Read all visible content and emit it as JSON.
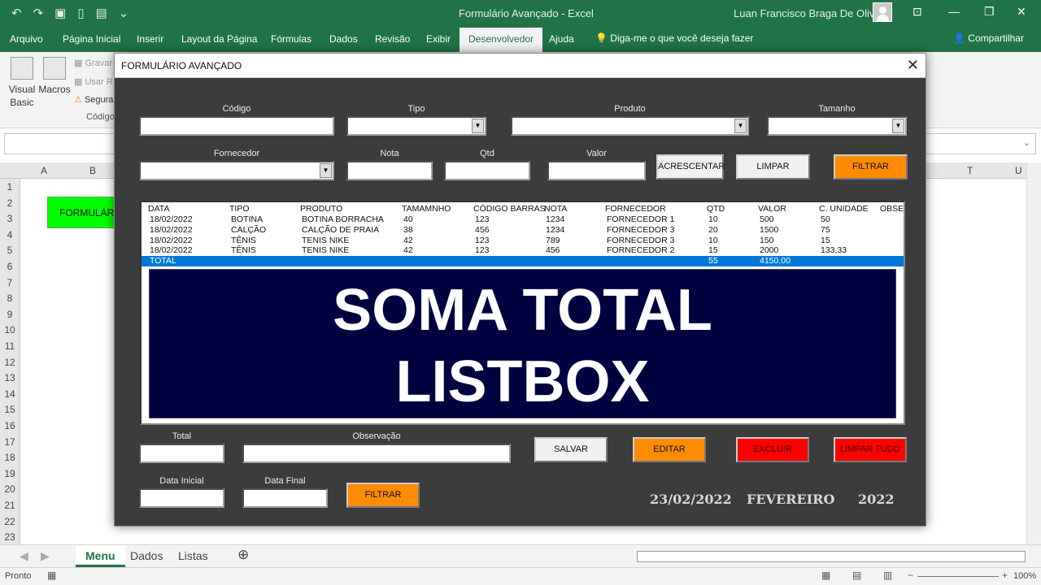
{
  "window": {
    "title": "Formulário Avançado  -  Excel",
    "user": "Luan Francisco Braga De Oliveira"
  },
  "ribbon_tabs": [
    "Arquivo",
    "Página Inicial",
    "Inserir",
    "Layout da Página",
    "Fórmulas",
    "Dados",
    "Revisão",
    "Exibir",
    "Desenvolvedor",
    "Ajuda"
  ],
  "active_tab": "Desenvolvedor",
  "tell_me": "Diga-me o que você deseja fazer",
  "share": "Compartilhar",
  "ribbon": {
    "visual_basic": "Visual Basic",
    "macros": "Macros",
    "gravar": "Gravar",
    "usar": "Usar R",
    "seguranca": "Segura",
    "group": "Código"
  },
  "columns": [
    "A",
    "B",
    "T",
    "U"
  ],
  "rows": [
    "1",
    "2",
    "3",
    "4",
    "5",
    "6",
    "7",
    "8",
    "9",
    "10",
    "11",
    "12",
    "13",
    "14",
    "15",
    "16",
    "17",
    "18",
    "19",
    "20",
    "21",
    "22",
    "23"
  ],
  "sheet_button": "FORMULÁRIO",
  "sheets": [
    "Menu",
    "Dados",
    "Listas"
  ],
  "status": "Pronto",
  "zoom": "100%",
  "form": {
    "title": "FORMULÁRIO AVANÇADO",
    "labels": {
      "codigo": "Código",
      "tipo": "Tipo",
      "produto": "Produto",
      "tamanho": "Tamanho",
      "fornecedor": "Fornecedor",
      "nota": "Nota",
      "qtd": "Qtd",
      "valor": "Valor",
      "total": "Total",
      "observacao": "Observação",
      "data_inicial": "Data Inicial",
      "data_final": "Data Final"
    },
    "buttons": {
      "acrescentar": "ACRESCENTAR",
      "limpar": "LIMPAR",
      "filtrar": "FILTRAR",
      "salvar": "SALVAR",
      "editar": "EDITAR",
      "excluir": "EXCLUIR",
      "limpar_tudo": "LIMPAR TUDO",
      "filtrar2": "FILTRAR"
    },
    "list_headers": [
      "DATA",
      "TIPO",
      "PRODUTO",
      "TAMAMNHO",
      "CÓDIGO BARRAS",
      "NOTA",
      "FORNECEDOR",
      "QTD",
      "VALOR",
      "C. UNIDADE",
      "OBSER"
    ],
    "list_rows": [
      [
        "18/02/2022",
        "BOTINA",
        "BOTINA BORRACHA",
        "40",
        "123",
        "1234",
        "FORNECEDOR 1",
        "10",
        "500",
        "50",
        ""
      ],
      [
        "18/02/2022",
        "CALÇÃO",
        "CALÇÃO DE PRAIA",
        "38",
        "456",
        "1234",
        "FORNECEDOR 3",
        "20",
        "1500",
        "75",
        ""
      ],
      [
        "18/02/2022",
        "TÊNIS",
        "TENIS NIKE",
        "42",
        "123",
        "789",
        "FORNECEDOR 3",
        "10",
        "150",
        "15",
        ""
      ],
      [
        "18/02/2022",
        "TÊNIS",
        "TENIS NIKE",
        "42",
        "123",
        "456",
        "FORNECEDOR 2",
        "15",
        "2000",
        "133,33",
        ""
      ]
    ],
    "total_row": [
      "TOTAL",
      "",
      "",
      "",
      "",
      "",
      "",
      "55",
      "4150,00",
      "",
      ""
    ],
    "banner_line1": "SOMA TOTAL",
    "banner_line2": "LISTBOX",
    "date": "23/02/2022",
    "month": "FEVEREIRO",
    "year": "2022"
  }
}
